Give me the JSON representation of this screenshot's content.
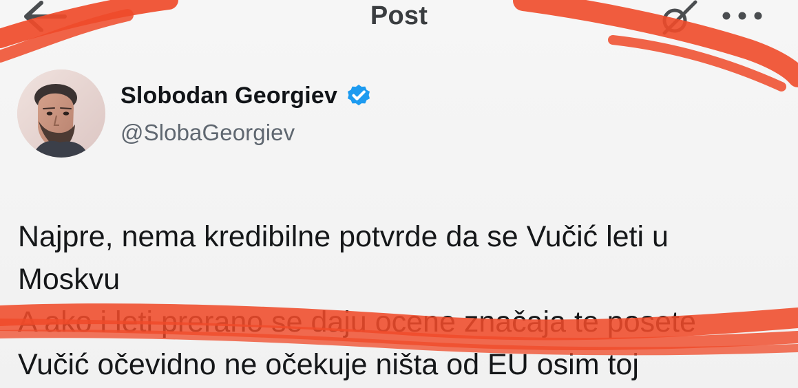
{
  "header": {
    "title": "Post",
    "back_icon": "back-arrow-icon",
    "grok_icon": "grok-icon",
    "more_icon": "more-options-icon"
  },
  "author": {
    "display_name": "Slobodan Georgiev",
    "handle": "@SlobaGeorgiev",
    "verified": true,
    "verified_color": "#1d9bf0"
  },
  "tweet": {
    "lines": [
      "Najpre, nema kredibilne potvrde da se Vučić leti u",
      "Moskvu",
      "A ako i leti prerano se daju ocene značaja te posete",
      "Vučić očevidno ne očekuje ništa od EU osim toj"
    ]
  },
  "annotation": {
    "color": "#ef4b2a"
  }
}
